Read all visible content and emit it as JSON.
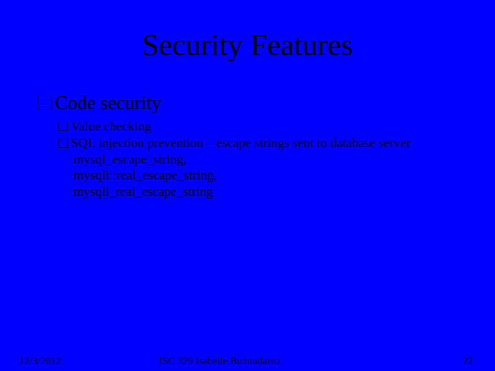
{
  "title": "Security Features",
  "level1": {
    "item1": "Code security"
  },
  "level2": {
    "item1": "Value checking",
    "item2_line1": "SQL injection prevention – escape strings sent to database server",
    "item2_line2": "mysql_escape_string,",
    "item2_line3": "mysqli::real_escape_string,",
    "item2_line4": "mysqli_real_escape_string"
  },
  "footer": {
    "date": "12/3/2012",
    "center": "ISC 329   Isabelle Bichindaritz",
    "page": "22"
  }
}
